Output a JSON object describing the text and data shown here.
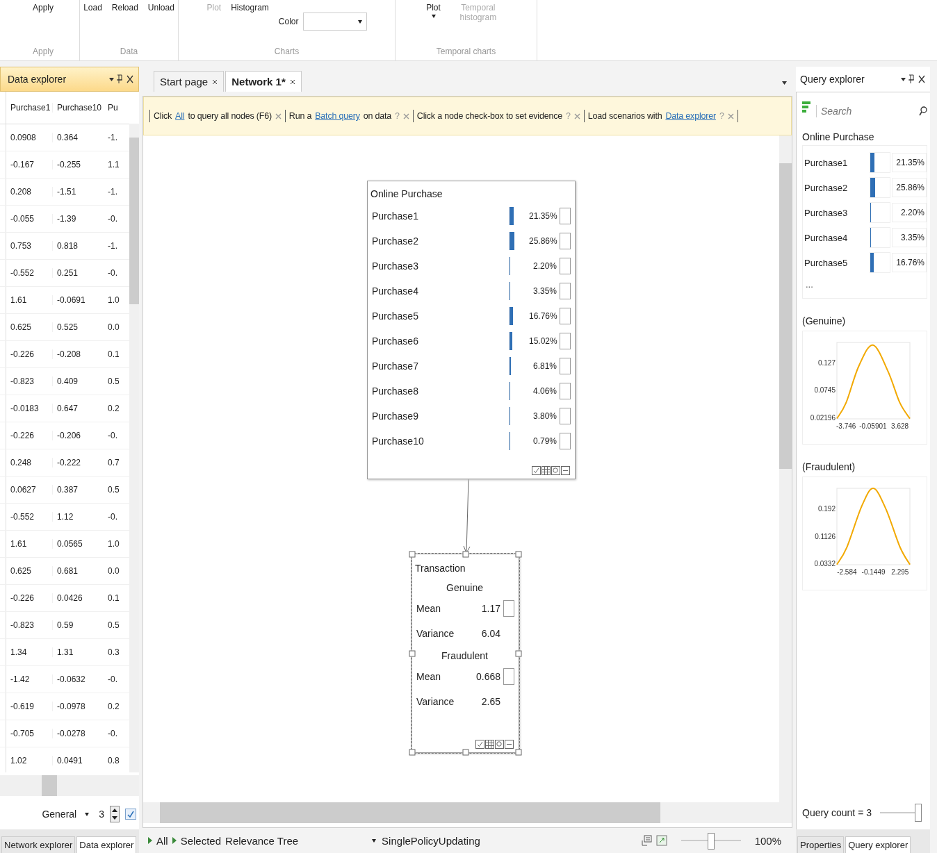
{
  "ribbon": {
    "groups": [
      {
        "label": "Apply",
        "items": [
          {
            "label": "Apply",
            "disabled": false,
            "dropdown": false
          }
        ]
      },
      {
        "label": "Data",
        "items": [
          {
            "label": "Load",
            "disabled": false,
            "dropdown": false
          },
          {
            "label": "Reload",
            "disabled": false,
            "dropdown": false
          },
          {
            "label": "Unload",
            "disabled": false,
            "dropdown": false
          }
        ]
      },
      {
        "label": "Charts",
        "items": [
          {
            "label": "Plot",
            "disabled": true,
            "dropdown": false
          },
          {
            "label": "Histogram",
            "disabled": false,
            "dropdown": false
          }
        ],
        "color_field": {
          "label": "Color"
        }
      },
      {
        "label": "Temporal charts",
        "items": [
          {
            "label": "Plot",
            "disabled": false,
            "dropdown": true
          },
          {
            "label": "Temporal histogram",
            "disabled": true,
            "dropdown": false
          }
        ]
      }
    ]
  },
  "data_explorer": {
    "title": "Data explorer",
    "columns": [
      "Purchase1",
      "Purchase10",
      "Pu"
    ],
    "rows": [
      [
        "0.0908",
        "0.364",
        "-1."
      ],
      [
        "-0.167",
        "-0.255",
        "1.1"
      ],
      [
        "0.208",
        "-1.51",
        "-1."
      ],
      [
        "-0.055",
        "-1.39",
        "-0."
      ],
      [
        "0.753",
        "0.818",
        "-1."
      ],
      [
        "-0.552",
        "0.251",
        "-0."
      ],
      [
        "1.61",
        "-0.0691",
        "1.0"
      ],
      [
        "0.625",
        "0.525",
        "0.0"
      ],
      [
        "-0.226",
        "-0.208",
        "0.1"
      ],
      [
        "-0.823",
        "0.409",
        "0.5"
      ],
      [
        "-0.0183",
        "0.647",
        "0.2"
      ],
      [
        "-0.226",
        "-0.206",
        "-0."
      ],
      [
        "0.248",
        "-0.222",
        "0.7"
      ],
      [
        "0.0627",
        "0.387",
        "0.5"
      ],
      [
        "-0.552",
        "1.12",
        "-0."
      ],
      [
        "1.61",
        "0.0565",
        "1.0"
      ],
      [
        "0.625",
        "0.681",
        "0.0"
      ],
      [
        "-0.226",
        "0.0426",
        "0.1"
      ],
      [
        "-0.823",
        "0.59",
        "0.5"
      ],
      [
        "1.34",
        "1.31",
        "0.3"
      ],
      [
        "-1.42",
        "-0.0632",
        "-0."
      ],
      [
        "-0.619",
        "-0.0978",
        "0.2"
      ],
      [
        "-0.705",
        "-0.0278",
        "-0."
      ],
      [
        "1.02",
        "0.0491",
        "0.8"
      ]
    ],
    "mode": "General",
    "count": "3",
    "option_checked": true,
    "tabs": [
      {
        "label": "Network explorer",
        "selected": false
      },
      {
        "label": "Data explorer",
        "selected": true
      }
    ]
  },
  "document_tabs": [
    {
      "label": "Start page",
      "selected": false
    },
    {
      "label": "Network 1*",
      "selected": true
    }
  ],
  "tips": [
    {
      "parts": [
        {
          "kind": "text",
          "text": "Click"
        },
        {
          "kind": "link",
          "text": "All"
        },
        {
          "kind": "text",
          "text": "to query all nodes (F6)"
        }
      ]
    },
    {
      "parts": [
        {
          "kind": "text",
          "text": "Run a"
        },
        {
          "kind": "link",
          "text": "Batch query"
        },
        {
          "kind": "text",
          "text": "on data"
        }
      ],
      "help": "?"
    },
    {
      "parts": [
        {
          "kind": "text",
          "text": "Click a node check-box to set evidence"
        }
      ],
      "help": "?"
    },
    {
      "parts": [
        {
          "kind": "text",
          "text": "Load scenarios with"
        },
        {
          "kind": "link",
          "text": "Data explorer"
        }
      ],
      "help": "?"
    }
  ],
  "nodes": [
    {
      "kind": "discrete",
      "title": "Online Purchase",
      "selected": false,
      "states": [
        {
          "name": "Purchase1",
          "level": 0.2135,
          "value": "21.35%",
          "checked": false
        },
        {
          "name": "Purchase2",
          "level": 0.2586,
          "value": "25.86%",
          "checked": false
        },
        {
          "name": "Purchase3",
          "level": 0.022,
          "value": "2.20%",
          "checked": false
        },
        {
          "name": "Purchase4",
          "level": 0.0335,
          "value": "3.35%",
          "checked": false
        },
        {
          "name": "Purchase5",
          "level": 0.1676,
          "value": "16.76%",
          "checked": false
        },
        {
          "name": "Purchase6",
          "level": 0.1502,
          "value": "15.02%",
          "checked": false
        },
        {
          "name": "Purchase7",
          "level": 0.0681,
          "value": "6.81%",
          "checked": false
        },
        {
          "name": "Purchase8",
          "level": 0.0406,
          "value": "4.06%",
          "checked": false
        },
        {
          "name": "Purchase9",
          "level": 0.038,
          "value": "3.80%",
          "checked": false
        },
        {
          "name": "Purchase10",
          "level": 0.0079,
          "value": "0.79%",
          "checked": false
        }
      ]
    },
    {
      "kind": "continuous",
      "title": "Transaction",
      "selected": true,
      "groups": [
        {
          "name": "Genuine",
          "mean_label": "Mean",
          "mean": "1.17",
          "checked": false,
          "variance_label": "Variance",
          "variance": "6.04"
        },
        {
          "name": "Fraudulent",
          "mean_label": "Mean",
          "mean": "0.668",
          "checked": false,
          "variance_label": "Variance",
          "variance": "2.65"
        }
      ]
    }
  ],
  "status_bar": {
    "all": "All",
    "selected": "Selected",
    "relevance": "Relevance Tree",
    "policy": "SinglePolicyUpdating",
    "zoom": "100%",
    "zoom_slider": {
      "level": 0.5
    }
  },
  "query_explorer": {
    "title": "Query explorer",
    "search": {
      "placeholder": "Search"
    },
    "summary": {
      "title": "Online Purchase",
      "rows": [
        {
          "name": "Purchase1",
          "level": 0.2135,
          "value": "21.35%"
        },
        {
          "name": "Purchase2",
          "level": 0.2586,
          "value": "25.86%"
        },
        {
          "name": "Purchase3",
          "level": 0.022,
          "value": "2.20%"
        },
        {
          "name": "Purchase4",
          "level": 0.0335,
          "value": "3.35%"
        },
        {
          "name": "Purchase5",
          "level": 0.1676,
          "value": "16.76%"
        }
      ],
      "more": "..."
    },
    "charts": [
      {
        "title": "(Genuine)",
        "chart_data": {
          "type": "line",
          "x": [
            -5,
            -3.746,
            -2,
            -0.059,
            2,
            3.628,
            5
          ],
          "series": [
            {
              "color": "#f2a900",
              "values": [
                0.02,
                0.05,
                0.12,
                0.16,
                0.11,
                0.05,
                0.02
              ]
            }
          ],
          "xlim": [
            -5,
            5
          ],
          "ylim": [
            0.0195,
            0.165
          ],
          "xticks": [
            -3.746,
            -0.05901,
            3.628
          ],
          "yticks": [
            0.02196,
            0.0745,
            0.127
          ]
        }
      },
      {
        "title": "(Fraudulent)",
        "chart_data": {
          "type": "line",
          "x": [
            -3.5,
            -2.584,
            -1.2,
            -0.1449,
            1,
            2.295,
            3.2
          ],
          "series": [
            {
              "color": "#f2a900",
              "values": [
                0.03,
                0.08,
                0.2,
                0.25,
                0.19,
                0.08,
                0.03
              ]
            }
          ],
          "xlim": [
            -3.5,
            3.2
          ],
          "ylim": [
            0.0294,
            0.25
          ],
          "xticks": [
            -2.584,
            -0.1449,
            2.295
          ],
          "yticks": [
            0.0332,
            0.1126,
            0.192
          ]
        }
      }
    ],
    "query_count": "Query count = 3",
    "count_slider": {
      "level": 1
    },
    "tabs": [
      {
        "label": "Properties",
        "selected": false
      },
      {
        "label": "Query explorer",
        "selected": true
      }
    ]
  }
}
